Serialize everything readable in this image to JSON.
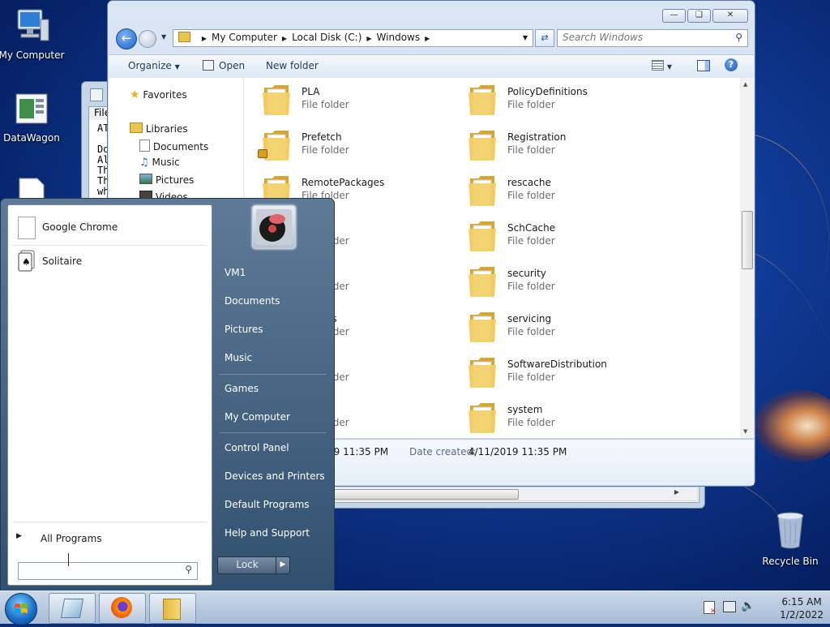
{
  "desktop": {
    "icons": [
      {
        "label": "My Computer"
      },
      {
        "label": "DataWagon"
      },
      {
        "label": "Recycle Bin"
      }
    ]
  },
  "notepad": {
    "menu_label": "File",
    "lines": [
      "ATT",
      "",
      "Dor",
      "All",
      "The",
      "Thi",
      "wha"
    ]
  },
  "explorer": {
    "breadcrumb": [
      "My Computer",
      "Local Disk (C:)",
      "Windows"
    ],
    "search_placeholder": "Search Windows",
    "toolbar": {
      "organize": "Organize",
      "open": "Open",
      "new_folder": "New folder"
    },
    "nav": {
      "favorites": "Favorites",
      "libraries": "Libraries",
      "documents": "Documents",
      "music": "Music",
      "pictures": "Pictures",
      "videos": "Videos"
    },
    "folders_left": [
      {
        "name": "PLA",
        "type": "File folder"
      },
      {
        "name": "Prefetch",
        "type": "File folder"
      },
      {
        "name": "RemotePackages",
        "type": "File folder"
      },
      {
        "name": "ces",
        "type": "File folder"
      },
      {
        "name": "s",
        "type": "File folder"
      },
      {
        "name": "Profiles",
        "type": "File folder"
      },
      {
        "name": "",
        "type": "File folder"
      },
      {
        "name": "",
        "type": "File folder"
      }
    ],
    "folders_right": [
      {
        "name": "PolicyDefinitions",
        "type": "File folder"
      },
      {
        "name": "Registration",
        "type": "File folder"
      },
      {
        "name": "rescache",
        "type": "File folder"
      },
      {
        "name": "SchCache",
        "type": "File folder"
      },
      {
        "name": "security",
        "type": "File folder"
      },
      {
        "name": "servicing",
        "type": "File folder"
      },
      {
        "name": "SoftwareDistribution",
        "type": "File folder"
      },
      {
        "name": "system",
        "type": "File folder"
      }
    ],
    "details": {
      "modified": "19 11:35 PM",
      "created_label": "Date created:",
      "created": "4/11/2019 11:35 PM"
    }
  },
  "start_menu": {
    "pinned": [
      {
        "label": "Google Chrome"
      },
      {
        "label": "Solitaire"
      }
    ],
    "all_programs": "All Programs",
    "right": {
      "user": "VM1",
      "documents": "Documents",
      "pictures": "Pictures",
      "music": "Music",
      "games": "Games",
      "my_computer": "My Computer",
      "control_panel": "Control Panel",
      "devices": "Devices and Printers",
      "default_programs": "Default Programs",
      "help": "Help and Support"
    },
    "lock": "Lock"
  },
  "taskbar": {
    "time": "6:15 AM",
    "date": "1/2/2022"
  }
}
